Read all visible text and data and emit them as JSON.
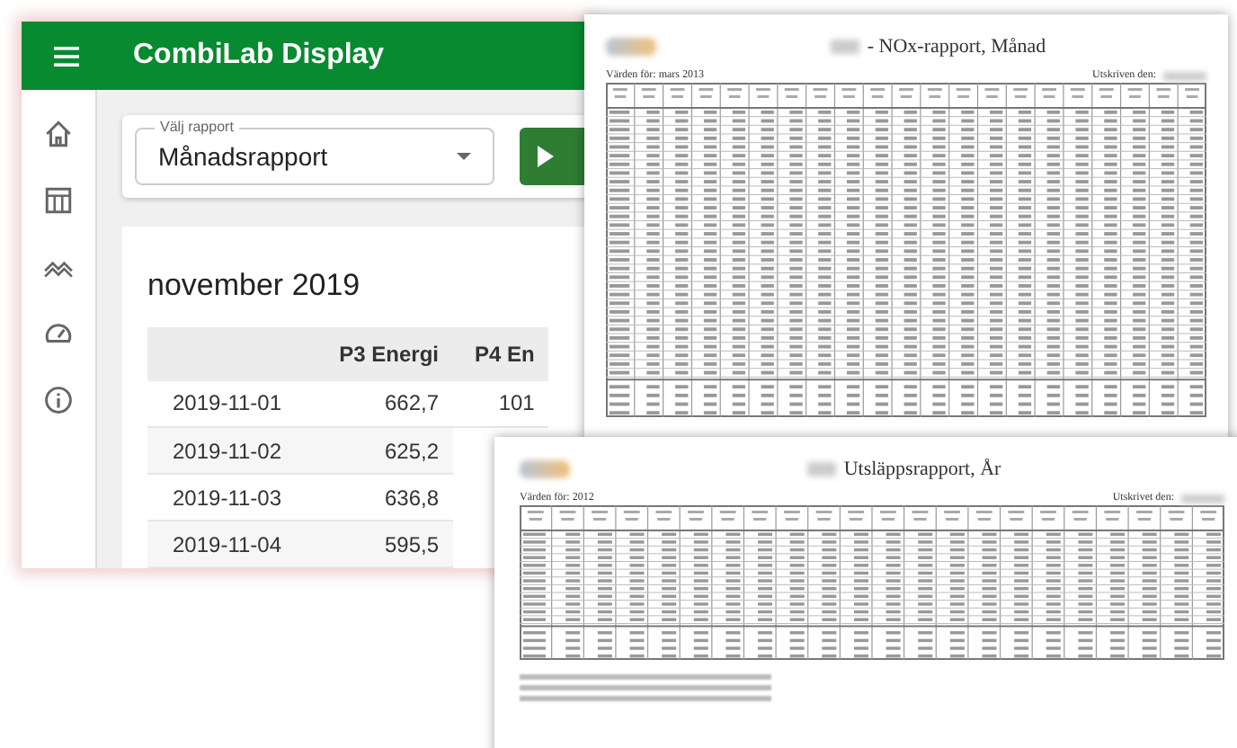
{
  "app": {
    "title": "CombiLab Display",
    "nav": [
      {
        "kind": "home"
      },
      {
        "kind": "table"
      },
      {
        "kind": "trend"
      },
      {
        "kind": "gauge"
      },
      {
        "kind": "info"
      }
    ],
    "report_select": {
      "label": "Välj rapport",
      "value": "Månadsrapport"
    },
    "period": "november 2019",
    "table": {
      "columns": [
        "",
        "P3 Energi",
        "P4 En"
      ],
      "rows": [
        [
          "2019-11-01",
          "662,7",
          "101"
        ],
        [
          "2019-11-02",
          "625,2"
        ],
        [
          "2019-11-03",
          "636,8"
        ],
        [
          "2019-11-04",
          "595,5"
        ]
      ]
    }
  },
  "reports": [
    {
      "title": "- NOx-rapport, Månad",
      "values_for": "Värden för:  mars 2013",
      "printed": "Utskriven den:",
      "kind": "monthly"
    },
    {
      "title": "Utsläppsrapport, År",
      "values_for": "Värden för:  2012",
      "printed": "Utskrivet den:",
      "kind": "yearly"
    }
  ]
}
